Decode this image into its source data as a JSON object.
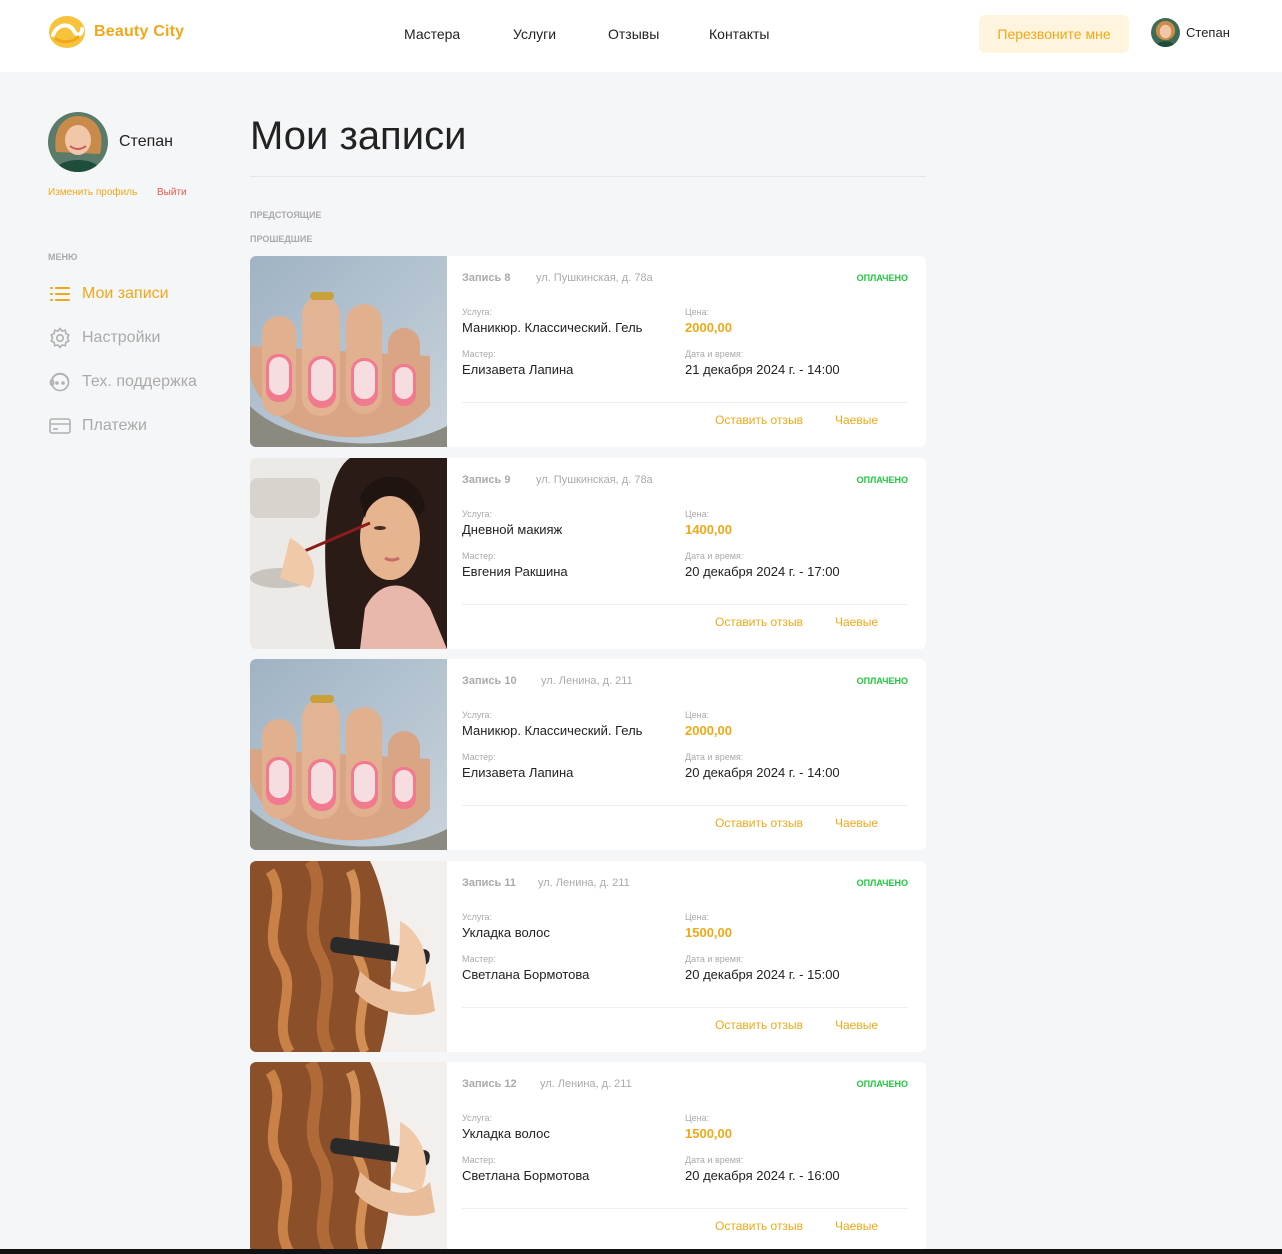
{
  "header": {
    "brand": "Beauty City",
    "nav": [
      "Мастера",
      "Услуги",
      "Отзывы",
      "Контакты"
    ],
    "callback_label": "Перезвоните мне",
    "user_name": "Степан"
  },
  "sidebar": {
    "user_name": "Степан",
    "edit_profile": "Изменить профиль",
    "logout": "Выйти",
    "menu_label": "МЕНЮ",
    "items": [
      {
        "label": "Мои записи",
        "icon": "list-icon",
        "active": true
      },
      {
        "label": "Настройки",
        "icon": "gear-icon",
        "active": false
      },
      {
        "label": "Тех. поддержка",
        "icon": "support-icon",
        "active": false
      },
      {
        "label": "Платежи",
        "icon": "card-icon",
        "active": false
      }
    ]
  },
  "main": {
    "title": "Мои записи",
    "tabs": [
      "ПРЕДСТОЯЩИЕ",
      "ПРОШЕДШИЕ"
    ],
    "labels": {
      "service": "Услуга:",
      "price": "Цена:",
      "master": "Мастер:",
      "datetime": "Дата и время:",
      "review": "Оставить отзыв",
      "tips": "Чаевые"
    },
    "records": [
      {
        "number": "Запись 8",
        "address": "ул. Пушкинская, д. 78а",
        "status": "ОПЛАЧЕНО",
        "service": "Маникюр. Классический. Гель",
        "price": "2000,00",
        "master": "Елизавета Лапина",
        "datetime": "21 декабря 2024 г. - 14:00",
        "image": "nails"
      },
      {
        "number": "Запись 9",
        "address": "ул. Пушкинская, д. 78а",
        "status": "ОПЛАЧЕНО",
        "service": "Дневной макияж",
        "price": "1400,00",
        "master": "Евгения Ракшина",
        "datetime": "20 декабря 2024 г. - 17:00",
        "image": "makeup"
      },
      {
        "number": "Запись 10",
        "address": "ул. Ленина, д. 211",
        "status": "ОПЛАЧЕНО",
        "service": "Маникюр. Классический. Гель",
        "price": "2000,00",
        "master": "Елизавета Лапина",
        "datetime": "20 декабря 2024 г. - 14:00",
        "image": "nails"
      },
      {
        "number": "Запись 11",
        "address": "ул. Ленина, д. 211",
        "status": "ОПЛАЧЕНО",
        "service": "Укладка волос",
        "price": "1500,00",
        "master": "Светлана Бормотова",
        "datetime": "20 декабря 2024 г. - 15:00",
        "image": "hair"
      },
      {
        "number": "Запись 12",
        "address": "ул. Ленина, д. 211",
        "status": "ОПЛАЧЕНО",
        "service": "Укладка волос",
        "price": "1500,00",
        "master": "Светлана Бормотова",
        "datetime": "20 декабря 2024 г. - 16:00",
        "image": "hair"
      }
    ]
  },
  "colors": {
    "accent": "#f0a818",
    "paid": "#1ec83c",
    "logout": "#e85a4f",
    "muted": "#aaaaaa"
  }
}
